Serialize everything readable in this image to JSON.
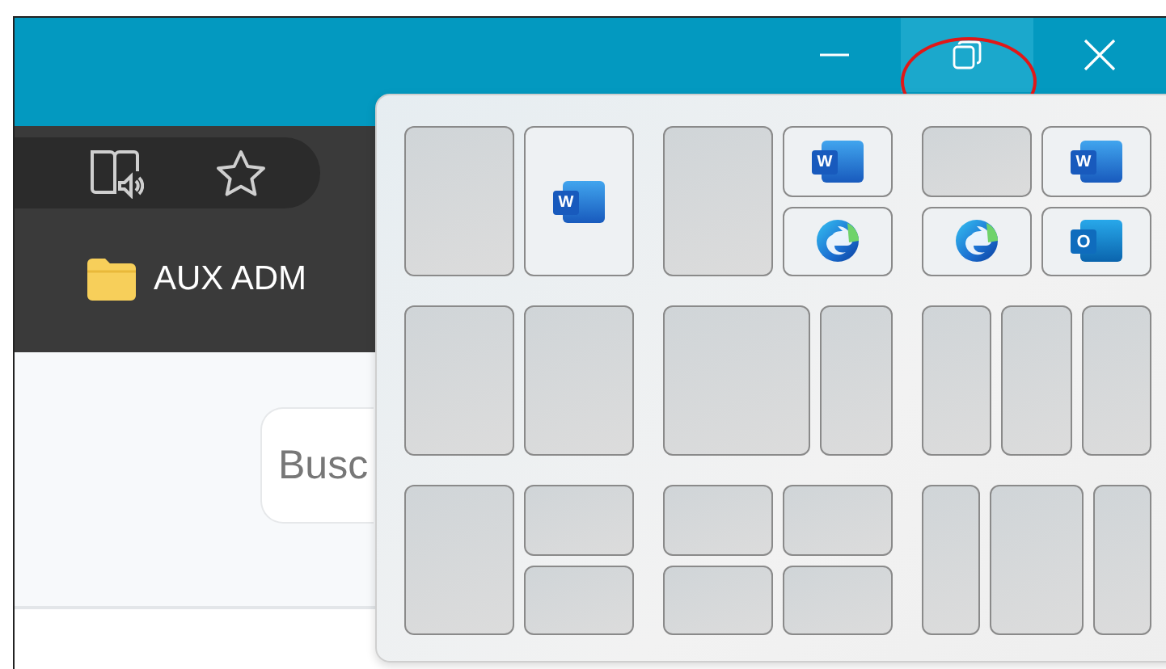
{
  "window": {
    "controls": [
      {
        "kind": "minimize",
        "highlighted": false
      },
      {
        "kind": "restore",
        "highlighted": true
      },
      {
        "kind": "close",
        "highlighted": false
      }
    ]
  },
  "toolbar": {
    "icons": [
      {
        "kind": "reader"
      },
      {
        "kind": "star"
      }
    ]
  },
  "bookmarks": [
    {
      "label": "AUX ADM",
      "kind": "folder"
    }
  ],
  "search": {
    "placeholder": "Busc"
  },
  "snap_layouts": [
    {
      "kind": "halves",
      "zones": [
        {
          "kind": "empty"
        },
        {
          "kind": "app",
          "app": {
            "kind": "word",
            "letter": "W"
          }
        }
      ]
    },
    {
      "kind": "left-stack",
      "zones": [
        {
          "kind": "empty"
        },
        {
          "kind": "app",
          "app": {
            "kind": "word",
            "letter": "W"
          }
        },
        {
          "kind": "app",
          "app": {
            "kind": "edge"
          }
        }
      ]
    },
    {
      "kind": "quad",
      "zones": [
        {
          "kind": "empty"
        },
        {
          "kind": "app",
          "app": {
            "kind": "word",
            "letter": "W"
          }
        },
        {
          "kind": "app",
          "app": {
            "kind": "edge"
          }
        },
        {
          "kind": "app",
          "app": {
            "kind": "outlook",
            "letter": "O"
          }
        }
      ]
    },
    {
      "kind": "halves",
      "zones": [
        {
          "kind": "empty"
        },
        {
          "kind": "empty"
        }
      ]
    },
    {
      "kind": "wide-narrow",
      "zones": [
        {
          "kind": "empty"
        },
        {
          "kind": "empty"
        }
      ]
    },
    {
      "kind": "thirds",
      "zones": [
        {
          "kind": "empty"
        },
        {
          "kind": "empty"
        },
        {
          "kind": "empty"
        }
      ]
    },
    {
      "kind": "left-stack",
      "zones": [
        {
          "kind": "empty"
        },
        {
          "kind": "empty"
        },
        {
          "kind": "empty"
        }
      ]
    },
    {
      "kind": "quad",
      "zones": [
        {
          "kind": "empty"
        },
        {
          "kind": "empty"
        },
        {
          "kind": "empty"
        },
        {
          "kind": "empty"
        }
      ]
    },
    {
      "kind": "wide-center",
      "zones": [
        {
          "kind": "empty"
        },
        {
          "kind": "empty"
        },
        {
          "kind": "empty"
        }
      ]
    }
  ]
}
